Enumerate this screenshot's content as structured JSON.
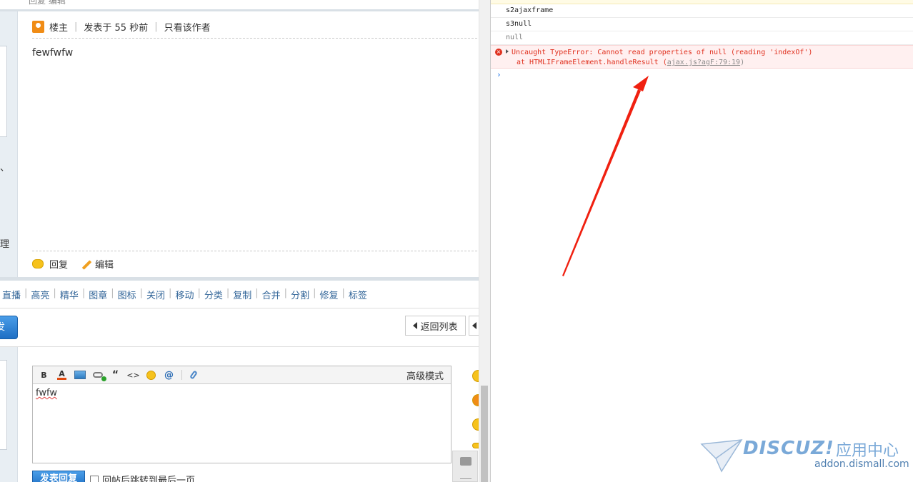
{
  "forum": {
    "cut_top_text": "回复  编辑",
    "post_header": {
      "author_label": "楼主",
      "posted_time": "发表于 55 秒前",
      "only_author": "只看该作者"
    },
    "post_content": "fewfwfw",
    "actions": {
      "reply": "回复",
      "edit": "编辑"
    },
    "side_chars": [
      "、",
      "理"
    ],
    "moderation_items": [
      "直播",
      "高亮",
      "精华",
      "图章",
      "图标",
      "关闭",
      "移动",
      "分类",
      "复制",
      "合并",
      "分割",
      "修复",
      "标签"
    ],
    "cut_button_label": "发",
    "back_to_list": "返回列表",
    "editor": {
      "toolbar_icons": [
        "bold-icon",
        "font-color-icon",
        "image-icon",
        "link-add-icon",
        "quote-icon",
        "code-icon",
        "smiley-icon",
        "at-icon",
        "attachment-icon"
      ],
      "toolbar_glyphs": {
        "bold": "B",
        "fontcolor": "A",
        "quote": "“",
        "code": "<>",
        "at": "@"
      },
      "advanced_mode": "高级模式",
      "content": "fwfw"
    },
    "submit_label": "发表回复",
    "jump_option": "回帖后跳转到最后一页"
  },
  "console": {
    "lines": [
      "s2ajaxframe",
      "s3null",
      "null"
    ],
    "error": {
      "message": "Uncaught TypeError: Cannot read properties of null (reading 'indexOf')",
      "stack_prefix": "at HTMLIFrameElement.handleResult (",
      "stack_link": "ajax.js?agF:79:19",
      "stack_suffix": ")"
    },
    "prompt_symbol": "›"
  },
  "watermark": {
    "logo": "DISCUZ!",
    "cn": "应用中心",
    "url": "addon.dismall.com"
  },
  "colors": {
    "error_red": "#e0301e",
    "arrow_red": "#f02010",
    "link_blue": "#336699",
    "button_blue": "#1e6fc4"
  }
}
